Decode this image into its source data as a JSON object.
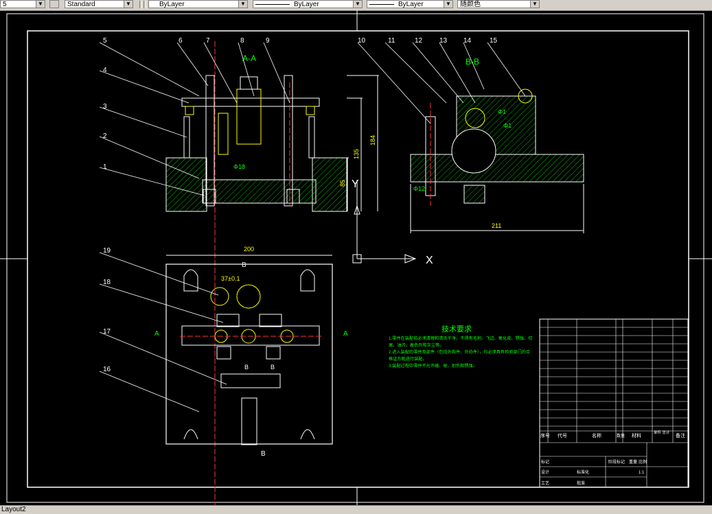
{
  "toolbar": {
    "first_value": "5",
    "text_style": "Standard",
    "layer": "ByLayer",
    "linetype": "ByLayer",
    "lineweight": "ByLayer",
    "color": "随颜色"
  },
  "status": {
    "layout_tab": "Layout2"
  },
  "drawing": {
    "section_aa": "A-A",
    "section_bb": "B-B",
    "balloons": [
      "1",
      "2",
      "3",
      "4",
      "5",
      "6",
      "7",
      "8",
      "9",
      "10",
      "11",
      "12",
      "13",
      "14",
      "15",
      "16",
      "17",
      "18",
      "19"
    ],
    "dims": {
      "d85": "85",
      "d135": "135",
      "d184": "184",
      "d211": "211",
      "d200": "200",
      "d37": "37±0.1",
      "phi_a": "Φ18",
      "phi_b": "Φ1",
      "phi_c": "Φ1",
      "phi_d": "Φ12"
    },
    "ucs": {
      "x": "X",
      "y": "Y"
    },
    "section_marks": {
      "a": "A",
      "b": "B"
    },
    "tech_title": "技术要求",
    "tech_lines": [
      "1.零件在装配前必须清理和清洗干净，不得有毛刺、飞边、氧化皮、锈蚀、切",
      "屑、油污、着色剂和灰尘等。",
      "2.进入装配的零件及部件（包括外购件、外协件），均必须具有检验部门的合",
      "格证方能进行装配。",
      "3.装配过程中零件不允许磕、碰、划伤和锈蚀。"
    ],
    "title_block": {
      "hdr_no": "序号",
      "hdr_code": "代号",
      "hdr_name": "名称",
      "hdr_qty": "数量",
      "hdr_material": "材料",
      "hdr_weight": "单件 总计",
      "hdr_note": "备注",
      "mark": "标记",
      "designer": "设计",
      "craft": "工艺",
      "standard": "标准化",
      "approve": "批准",
      "stage": "阶段标记",
      "weight": "重量",
      "scale": "比例",
      "scale_val": "1:1"
    }
  }
}
